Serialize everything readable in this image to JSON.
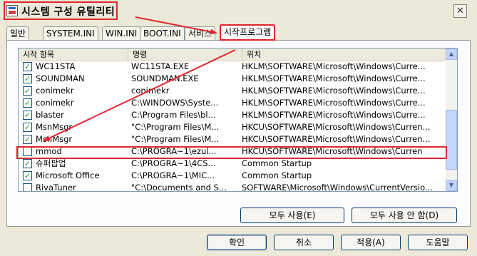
{
  "window": {
    "title": "시스템 구성 유틸리티",
    "close_label": "✕"
  },
  "tabs": [
    {
      "label": "일반"
    },
    {
      "label": "SYSTEM.INI"
    },
    {
      "label": "WIN.INI"
    },
    {
      "label": "BOOT.INI"
    },
    {
      "label": "서비스"
    },
    {
      "label": "시작프로그램",
      "active": true
    }
  ],
  "list": {
    "columns": [
      "시작 항목",
      "명령",
      "위치"
    ],
    "rows": [
      {
        "checked": true,
        "item": "WC11STA",
        "command": "WC11STA.EXE",
        "location": "HKLM\\SOFTWARE\\Microsoft\\Windows\\Curre..."
      },
      {
        "checked": true,
        "item": "SOUNDMAN",
        "command": "SOUNDMAN.EXE",
        "location": "HKLM\\SOFTWARE\\Microsoft\\Windows\\Curre..."
      },
      {
        "checked": true,
        "item": "conimekr",
        "command": "conimekr",
        "location": "HKLM\\SOFTWARE\\Microsoft\\Windows\\Curre..."
      },
      {
        "checked": true,
        "item": "conimekr",
        "command": "C:\\WINDOWS\\Syste...",
        "location": "HKLM\\SOFTWARE\\Microsoft\\Windows\\Curre..."
      },
      {
        "checked": true,
        "item": "blaster",
        "command": "C:\\Program Files\\bl...",
        "location": "HKLM\\SOFTWARE\\Microsoft\\Windows\\Curre..."
      },
      {
        "checked": true,
        "item": "MsnMsgr",
        "command": "\"C:\\Program Files\\M...",
        "location": "HKCU\\SOFTWARE\\Microsoft\\Windows\\Curren..."
      },
      {
        "checked": true,
        "item": "MsnMsgr",
        "command": "\"C:\\Program Files\\M...",
        "location": "HKCU\\SOFTWARE\\Microsoft\\Windows\\Curren..."
      },
      {
        "checked": false,
        "item": "mmod",
        "command": "C:\\PROGRA~1\\ezul...",
        "location": "HKCU\\SOFTWARE\\Microsoft\\Windows\\Curren"
      },
      {
        "checked": true,
        "item": "슈퍼팝업",
        "command": "C:\\PROGRA~1\\4CS...",
        "location": "Common Startup"
      },
      {
        "checked": true,
        "item": "Microsoft Office",
        "command": "C:\\PROGRA~1\\MIC...",
        "location": "Common Startup"
      },
      {
        "checked": false,
        "item": "RivaTuner",
        "command": "\"C:\\Documents and S...",
        "location": "SOFTWARE\\Microsoft\\Windows\\CurrentVersio..."
      }
    ]
  },
  "buttons": {
    "enable_all": "모두 사용(E)",
    "disable_all": "모두 사용 안 함(D)",
    "ok": "확인",
    "cancel": "취소",
    "apply": "적용(A)",
    "help": "도움말"
  },
  "colors": {
    "highlight_red": "#e0262e",
    "checkmark_green": "#21a121",
    "face": "#ece9d8"
  }
}
